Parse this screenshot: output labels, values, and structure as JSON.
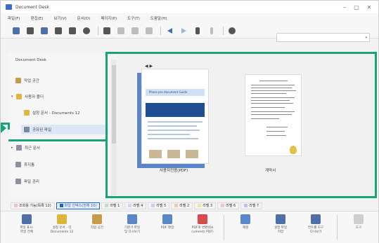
{
  "window": {
    "title": "Document Desk",
    "accent_color": "#1aa37a",
    "controls": [
      "–",
      "▢",
      "✕"
    ]
  },
  "menu": [
    "파일(F)",
    "편집(E)",
    "보기(V)",
    "문서(D)",
    "페이지(P)",
    "도구(T)",
    "도움말(H)"
  ],
  "sidebar": {
    "header": "Document Desk",
    "items": [
      {
        "label": "작업 공간",
        "icon": "pin-icon",
        "indent": 0,
        "expand": ""
      },
      {
        "label": "사용자 폴더",
        "icon": "folder-icon",
        "indent": 0,
        "expand": "▾"
      },
      {
        "label": "설정 문서 - Documents 12",
        "icon": "folder-icon",
        "indent": 1,
        "expand": ""
      },
      {
        "label": "공유된 파일",
        "icon": "lock-folder-icon",
        "indent": 1,
        "expand": "",
        "selected": true
      },
      {
        "label": "최근 문서",
        "icon": "folder-icon",
        "indent": 0,
        "expand": "▸"
      },
      {
        "label": "휴지통",
        "icon": "trash-icon",
        "indent": 0,
        "expand": ""
      },
      {
        "label": "파일 관리",
        "icon": "files-icon",
        "indent": 0,
        "expand": ""
      }
    ]
  },
  "content": {
    "documents": [
      {
        "caption": "사용자전용(PDF)",
        "page_nav": "◀ ▶",
        "heading": "Phase pro document Guide"
      },
      {
        "caption": "계약서"
      }
    ]
  },
  "status_tags": [
    {
      "label": "조회용 기능(목록 12)",
      "color": "#f2c1c1",
      "active": false
    },
    {
      "label": "파일 인덱스(전체 10)",
      "color": "#1b64c8",
      "active": true
    },
    {
      "label": "라벨 1",
      "color": "#b9e3b9",
      "active": false
    },
    {
      "label": "라벨 4",
      "color": "#cbd9f4",
      "active": false
    },
    {
      "label": "라벨 5",
      "color": "#d9c3f0",
      "active": false
    },
    {
      "label": "라벨 2",
      "color": "#f5c7a8",
      "active": false
    },
    {
      "label": "라벨 3",
      "color": "#f3e6a3",
      "active": false
    },
    {
      "label": "라벨 6",
      "color": "#f1c3d7",
      "active": false
    },
    {
      "label": "라벨 7",
      "color": "#cbb7ee",
      "active": false
    }
  ],
  "bottom_tools": [
    {
      "label": "파일 표시·\n파일 전체",
      "color": "#4f6fa8"
    },
    {
      "label": "설정 문서 - 각\nDocuments 12",
      "color": "#e0b63a"
    },
    {
      "label": "작업 공간",
      "color": "#c99a4a"
    },
    {
      "label": "기본기 파일\n및 다시보기",
      "color": "#5a87c7"
    },
    {
      "label": "PDF 편집",
      "color": "#5a87c7"
    },
    {
      "label": "PDF로 변환(Do\ncuments PDF)",
      "color": "#d94b4b"
    },
    {
      "label": "재생",
      "color": "#5a87c7"
    },
    {
      "label": "설정 파일\n저장",
      "color": "#4f6fa8"
    },
    {
      "label": "컨트롤 도구\n다시보기",
      "color": "#4f6fa8"
    },
    {
      "label": "도구",
      "color": "#cfcfcf"
    }
  ]
}
